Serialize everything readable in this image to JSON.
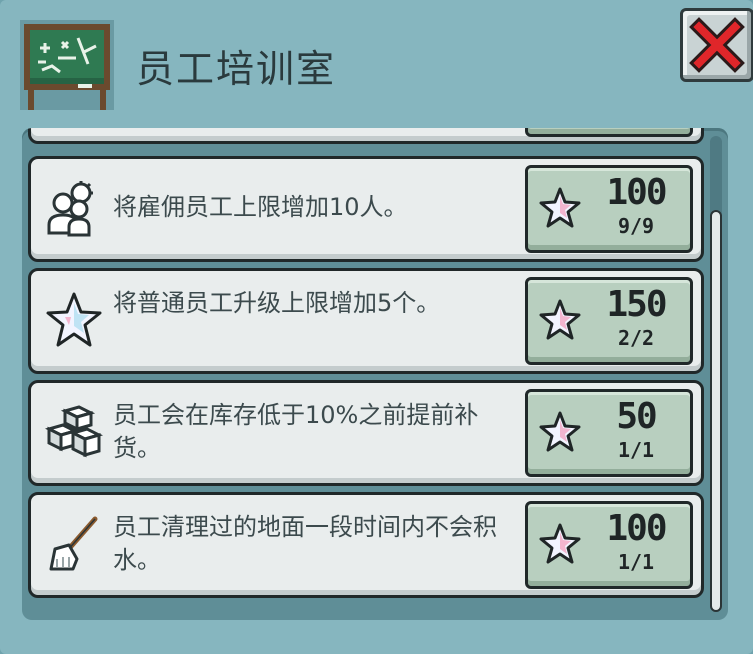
{
  "window": {
    "title": "员工培训室"
  },
  "upgrades": [
    {
      "desc": "将雇佣员工上限增加10人。",
      "cost": "100",
      "count": "9/9",
      "icon": "staff-group-icon"
    },
    {
      "desc": "将普通员工升级上限增加5个。",
      "cost": "150",
      "count": "2/2",
      "icon": "star-icon"
    },
    {
      "desc": "员工会在库存低于10%之前提前补货。",
      "cost": "50",
      "count": "1/1",
      "icon": "stock-boxes-icon"
    },
    {
      "desc": "员工清理过的地面一段时间内不会积水。",
      "cost": "100",
      "count": "1/1",
      "icon": "mop-icon"
    }
  ],
  "colors": {
    "star_fill": "#f2f4ff",
    "star_tint": "#f3b5cf",
    "cost_bg": "#b8cfbf",
    "close_x": "#e0262a"
  }
}
